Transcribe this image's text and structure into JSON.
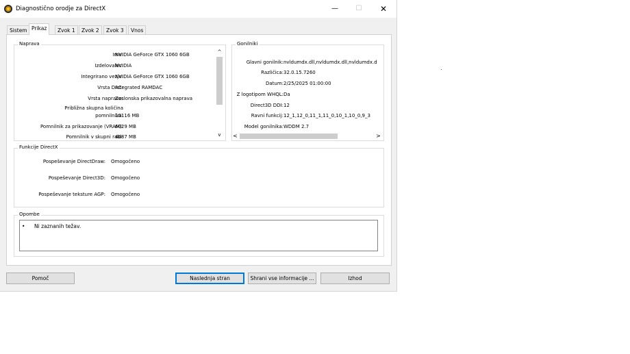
{
  "window": {
    "title": "Diagnostično orodje za DirectX",
    "controls": {
      "minimize": "—",
      "maximize": "☐",
      "close": "✕"
    }
  },
  "tabs": [
    "Sistem",
    "Prikaz",
    "Zvok 1",
    "Zvok 2",
    "Zvok 3",
    "Vnos"
  ],
  "active_tab": "Prikaz",
  "device": {
    "label": "Naprava",
    "fields": [
      {
        "key": "Ime:",
        "value": "NVIDIA GeForce GTX 1060 6GB"
      },
      {
        "key": "Izdelovalec:",
        "value": "NVIDIA"
      },
      {
        "key": "Integrirano vezje:",
        "value": "NVIDIA GeForce GTX 1060 6GB"
      },
      {
        "key": "Vrsta DAC:",
        "value": "Integrated RAMDAC"
      },
      {
        "key": "Vrsta naprave:",
        "value": "Zaslonska prikazovalna naprava"
      },
      {
        "key_line1": "Približna skupna količina",
        "key": "pomnilnika:",
        "value": "10116 MB"
      },
      {
        "key": "Pomnilnik za prikazovanje (VRAM):",
        "value": "6029 MB"
      },
      {
        "key": "Pomnilnik v skupni rabi:",
        "value": "4087 MB"
      }
    ]
  },
  "drivers": {
    "label": "Gonilniki",
    "fields": [
      {
        "key": "Glavni gonilnik:",
        "value": "nvldumdx.dll,nvldumdx.dll,nvldumdx.d"
      },
      {
        "key": "Različica:",
        "value": "32.0.15.7260"
      },
      {
        "key": "Datum:",
        "value": "2/25/2025 01:00:00"
      },
      {
        "key": "Z logotipom WHQL:",
        "value": "Da"
      },
      {
        "key": "Direct3D DDI:",
        "value": "12"
      },
      {
        "key": "Ravni funkcij:",
        "value": "12_1,12_0,11_1,11_0,10_1,10_0,9_3"
      },
      {
        "key": "Model gonilnika:",
        "value": "WDDM 2.7"
      }
    ]
  },
  "features": {
    "label": "Funkcije DirectX",
    "fields": [
      {
        "key": "Pospeševanje DirectDraw:",
        "value": "Omogočeno"
      },
      {
        "key": "Pospeševanje Direct3D:",
        "value": "Omogočeno"
      },
      {
        "key": "Pospeševanje teksture AGP:",
        "value": "Omogočeno"
      }
    ]
  },
  "notes": {
    "label": "Opombe",
    "bullet": "•",
    "items": [
      "Ni zaznanih težav."
    ]
  },
  "buttons": {
    "help": "Pomoč",
    "next_page": "Naslednja stran",
    "save_all": "Shrani vse informacije ...",
    "exit": "Izhod"
  },
  "scroll_arrows": {
    "up": "^",
    "down": "v",
    "left": "<",
    "right": ">"
  }
}
